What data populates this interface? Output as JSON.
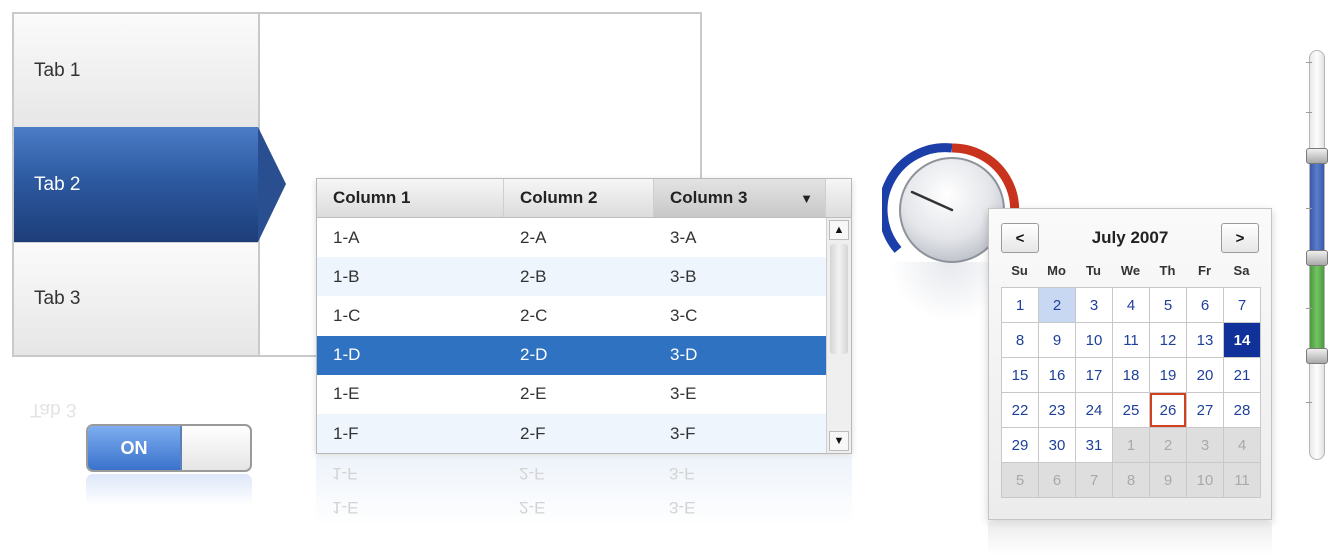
{
  "tabs": {
    "items": [
      {
        "label": "Tab 1"
      },
      {
        "label": "Tab 2",
        "selected": true
      },
      {
        "label": "Tab 3"
      }
    ],
    "reflection_text": "Tab 3"
  },
  "toggle": {
    "on_label": "ON",
    "state": "on"
  },
  "grid": {
    "columns": [
      "Column 1",
      "Column 2",
      "Column 3"
    ],
    "sorted_column": "Column 3",
    "rows": [
      [
        "1-A",
        "2-A",
        "3-A"
      ],
      [
        "1-B",
        "2-B",
        "3-B"
      ],
      [
        "1-C",
        "2-C",
        "3-C"
      ],
      [
        "1-D",
        "2-D",
        "3-D"
      ],
      [
        "1-E",
        "2-E",
        "3-E"
      ],
      [
        "1-F",
        "2-F",
        "3-F"
      ]
    ],
    "selected_row": 3,
    "reflection_rows": [
      [
        "1-F",
        "2-F",
        "3-F"
      ],
      [
        "1-E",
        "2-E",
        "3-E"
      ]
    ]
  },
  "gauge": {
    "value_fraction": 0.15,
    "colors": {
      "left_arc": "#1c3ea8",
      "right_arc": "#c9331d"
    }
  },
  "calendar": {
    "prev_label": "<",
    "next_label": ">",
    "title": "July 2007",
    "weekdays": [
      "Su",
      "Mo",
      "Tu",
      "We",
      "Th",
      "Fr",
      "Sa"
    ],
    "days": [
      {
        "d": "1"
      },
      {
        "d": "2",
        "state": "hover"
      },
      {
        "d": "3"
      },
      {
        "d": "4"
      },
      {
        "d": "5"
      },
      {
        "d": "6"
      },
      {
        "d": "7"
      },
      {
        "d": "8"
      },
      {
        "d": "9"
      },
      {
        "d": "10"
      },
      {
        "d": "11"
      },
      {
        "d": "12"
      },
      {
        "d": "13"
      },
      {
        "d": "14",
        "state": "sel"
      },
      {
        "d": "15"
      },
      {
        "d": "16"
      },
      {
        "d": "17"
      },
      {
        "d": "18"
      },
      {
        "d": "19"
      },
      {
        "d": "20"
      },
      {
        "d": "21"
      },
      {
        "d": "22"
      },
      {
        "d": "23"
      },
      {
        "d": "24"
      },
      {
        "d": "25"
      },
      {
        "d": "26",
        "state": "today"
      },
      {
        "d": "27"
      },
      {
        "d": "28"
      },
      {
        "d": "29"
      },
      {
        "d": "30"
      },
      {
        "d": "31"
      },
      {
        "d": "1",
        "state": "other"
      },
      {
        "d": "2",
        "state": "other"
      },
      {
        "d": "3",
        "state": "other"
      },
      {
        "d": "4",
        "state": "other"
      },
      {
        "d": "5",
        "state": "other"
      },
      {
        "d": "6",
        "state": "other"
      },
      {
        "d": "7",
        "state": "other"
      },
      {
        "d": "8",
        "state": "other"
      },
      {
        "d": "9",
        "state": "other"
      },
      {
        "d": "10",
        "state": "other"
      },
      {
        "d": "11",
        "state": "other"
      }
    ]
  },
  "slider": {
    "handles": [
      0.25,
      0.5,
      0.75
    ],
    "colors": {
      "blue": "#4666b8",
      "green": "#62ad52"
    }
  }
}
